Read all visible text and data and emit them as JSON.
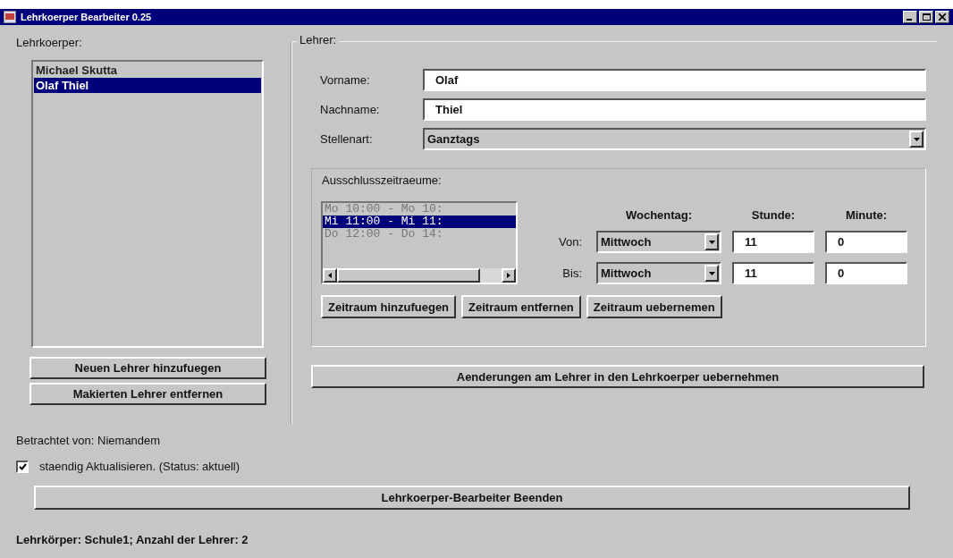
{
  "window": {
    "title": "Lehrkoerper Bearbeiter 0.25"
  },
  "teachers": {
    "label": "Lehrkoerper:",
    "items": [
      {
        "name": "Michael Skutta",
        "selected": false
      },
      {
        "name": "Olaf Thiel",
        "selected": true
      }
    ],
    "buttons": [
      "Neuen Lehrer hinzufuegen",
      "Makierten Lehrer entfernen"
    ]
  },
  "teacher": {
    "label": "Lehrer:",
    "fields": [
      {
        "kind": "text",
        "label": "Vorname:",
        "value": "Olaf"
      },
      {
        "kind": "text",
        "label": "Nachname:",
        "value": "Thiel"
      },
      {
        "kind": "combo",
        "label": "Stellenart:",
        "value": "Ganztags"
      }
    ],
    "exclusions": {
      "label": "Ausschlusszeitraeume:",
      "items": [
        {
          "text": "Mo 10:00 - Mo 10:",
          "selected": false
        },
        {
          "text": "Mi 11:00 - Mi 11:",
          "selected": true
        },
        {
          "text": "Do 12:00 - Do 14:",
          "selected": false
        }
      ],
      "headers": [
        "Wochentag:",
        "Stunde:",
        "Minute:"
      ],
      "rows": [
        {
          "label": "Von:",
          "day": "Mittwoch",
          "hour": "11",
          "minute": "0"
        },
        {
          "label": "Bis:",
          "day": "Mittwoch",
          "hour": "11",
          "minute": "0"
        }
      ],
      "buttons": [
        "Zeitraum hinzufuegen",
        "Zeitraum entfernen",
        "Zeitraum uebernemen"
      ]
    },
    "apply_button": "Aenderungen am Lehrer in den Lehrkoerper uebernehmen"
  },
  "viewed_by": "Betrachtet von: Niemandem",
  "auto_update": {
    "label": "staendig Aktualisieren. (Status: aktuell)",
    "checked": true
  },
  "quit_button": "Lehrkoerper-Bearbeiter Beenden",
  "status_bar": "Lehrkörper: Schule1; Anzahl der Lehrer: 2"
}
